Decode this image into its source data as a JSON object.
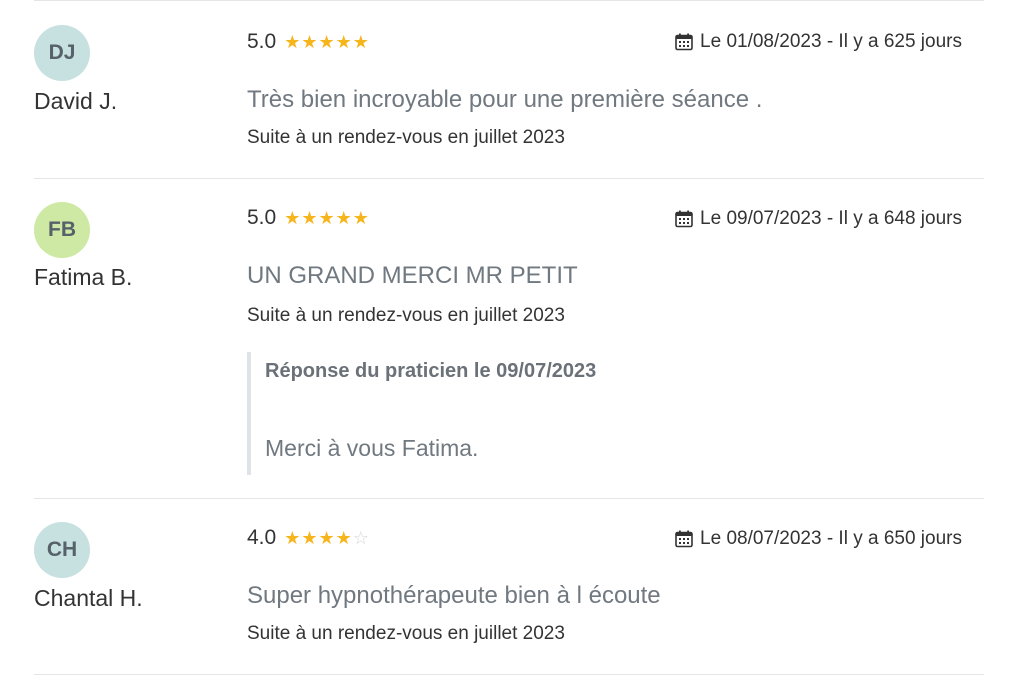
{
  "reviews": [
    {
      "initials": "DJ",
      "avatar_color": "#c7e0e0",
      "author": "David J.",
      "score": "5.0",
      "stars": 5,
      "date_text": "Le 01/08/2023 - Il y a 625 jours",
      "comment": "Très bien incroyable pour une première séance .",
      "context": "Suite à un rendez-vous en juillet 2023"
    },
    {
      "initials": "FB",
      "avatar_color": "#cde9a3",
      "author": "Fatima B.",
      "score": "5.0",
      "stars": 5,
      "date_text": "Le 09/07/2023 - Il y a 648 jours",
      "comment": "UN GRAND MERCI MR PETIT",
      "context": "Suite à un rendez-vous en juillet 2023",
      "reply": {
        "title": "Réponse du praticien le 09/07/2023",
        "text": "Merci à vous Fatima."
      }
    },
    {
      "initials": "CH",
      "avatar_color": "#c7e0e0",
      "author": "Chantal H.",
      "score": "4.0",
      "stars": 4,
      "date_text": "Le 08/07/2023 - Il y a 650 jours",
      "comment": "Super hypnothérapeute bien à l écoute",
      "context": "Suite à un rendez-vous en juillet 2023"
    }
  ],
  "star_max": 5,
  "icons": {
    "calendar": "calendar-icon",
    "star": "star-icon"
  },
  "colors": {
    "star_filled": "#f6b51a",
    "star_empty": "#d6d6d6"
  }
}
